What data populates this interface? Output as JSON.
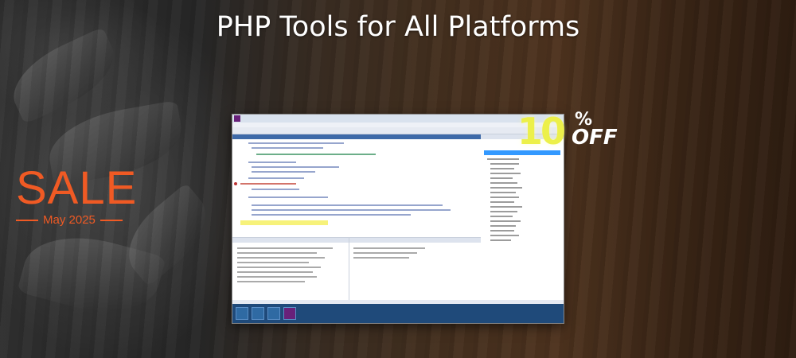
{
  "title": "PHP Tools for All Platforms",
  "sale": {
    "word": "SALE",
    "date": "May 2025"
  },
  "discount": {
    "value": "10",
    "percent": "%",
    "off": "OFF"
  },
  "colors": {
    "sale_accent": "#f05a24",
    "discount_yellow": "#ecf04a",
    "title": "#ffffff"
  },
  "screenshot": {
    "app": "Visual Studio",
    "icons": [
      "visual-studio-logo-icon",
      "file-explorer-icon",
      "internet-explorer-icon",
      "visual-studio-taskbar-icon"
    ]
  }
}
